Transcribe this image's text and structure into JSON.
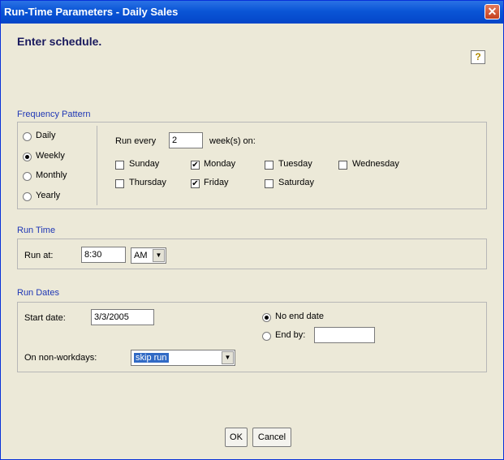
{
  "window": {
    "title": "Run-Time Parameters - Daily Sales",
    "close_glyph": "✕"
  },
  "heading": "Enter schedule.",
  "help_glyph": "?",
  "frequency": {
    "label": "Frequency Pattern",
    "options": [
      "Daily",
      "Weekly",
      "Monthly",
      "Yearly"
    ],
    "selected": "Weekly",
    "run_every_label": "Run every",
    "run_every_value": "2",
    "weeks_on_label": "week(s) on:",
    "days": [
      {
        "name": "Sunday",
        "checked": false
      },
      {
        "name": "Monday",
        "checked": true
      },
      {
        "name": "Tuesday",
        "checked": false
      },
      {
        "name": "Wednesday",
        "checked": false
      },
      {
        "name": "Thursday",
        "checked": false
      },
      {
        "name": "Friday",
        "checked": true
      },
      {
        "name": "Saturday",
        "checked": false
      }
    ],
    "check_glyph": "✔"
  },
  "run_time": {
    "label": "Run Time",
    "run_at_label": "Run at:",
    "time": "8:30",
    "ampm": "AM"
  },
  "run_dates": {
    "label": "Run Dates",
    "start_label": "Start date:",
    "start_value": "3/3/2005",
    "no_end_label": "No end date",
    "end_by_label": "End by:",
    "end_by_value": "",
    "end_selected": "No end date",
    "nonwork_label": "On non-workdays:",
    "nonwork_value": "skip run"
  },
  "buttons": {
    "ok": "OK",
    "cancel": "Cancel"
  },
  "dropdown_glyph": "▼"
}
